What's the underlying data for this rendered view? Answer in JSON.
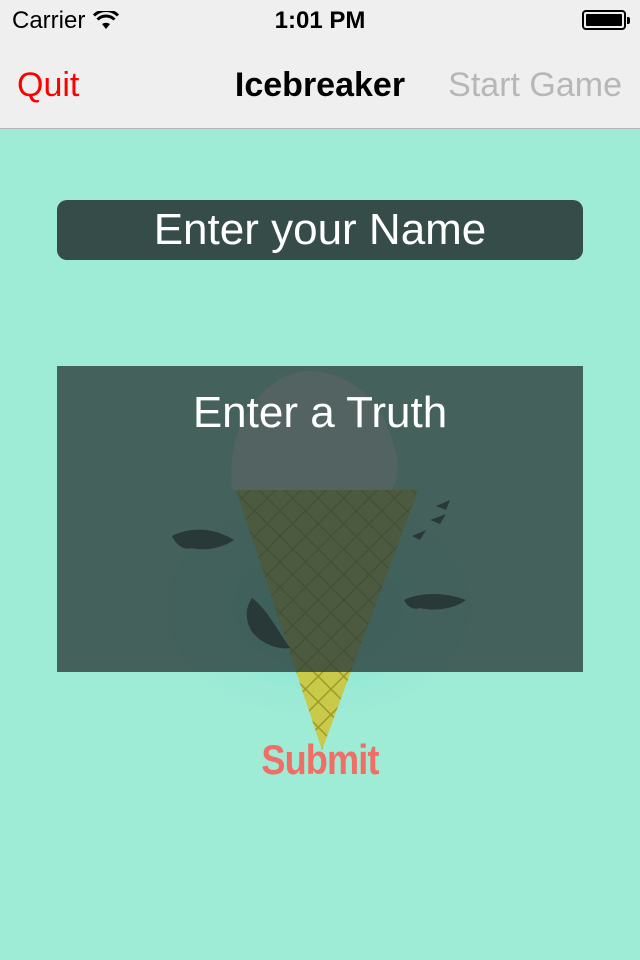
{
  "status_bar": {
    "carrier": "Carrier",
    "time": "1:01 PM",
    "wifi_icon": "wifi-icon",
    "battery_icon": "battery-icon",
    "battery_level": 1.0
  },
  "nav": {
    "left_label": "Quit",
    "title": "Icebreaker",
    "right_label": "Start Game",
    "left_color": "#ff0000",
    "right_color": "#b7b7b7"
  },
  "form": {
    "name_placeholder": "Enter your Name",
    "truth_placeholder": "Enter a Truth",
    "submit_label": "Submit",
    "submit_color": "#f06e66"
  },
  "background": {
    "color": "#9eebd6",
    "illustration": "ice-cream-cone-iceberg-with-orcas"
  }
}
